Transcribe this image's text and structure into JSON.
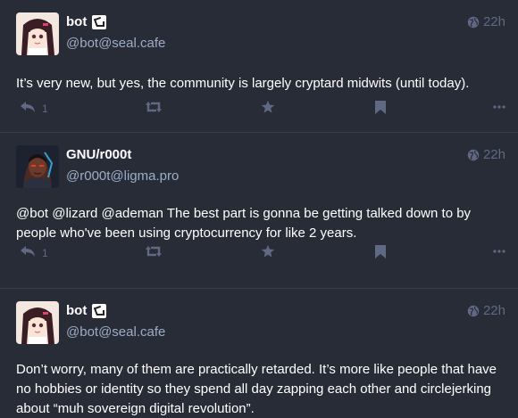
{
  "colors": {
    "background": "#282c37",
    "divider": "#393f4f",
    "text": "#ffffff",
    "muted": "#9baec8",
    "icon": "#606984"
  },
  "posts": [
    {
      "display_name": "bot",
      "acct": "@bot@seal.cafe",
      "time": "22h",
      "content": "It’s very new, but yes, the community is largely cryptard midwits (until today).",
      "reply_count": "1",
      "avatar": "anime-girl-avatar"
    },
    {
      "display_name": "GNU/r000t",
      "acct": "@r000t@ligma.pro",
      "time": "22h",
      "content": "@bot @lizard @ademan The best part is gonna be getting talked down to by people who've been using cryptocurrency for like 2 years.",
      "reply_count": "1",
      "avatar": "dark-character-avatar"
    },
    {
      "display_name": "bot",
      "acct": "@bot@seal.cafe",
      "time": "22h",
      "content": "Don’t worry, many of them are practically retarded. It’s more like people that have no hobbies or identity so they spend all day zapping each other and circlejerking about “muh sovereign digital revolution”.",
      "avatar": "anime-girl-avatar"
    }
  ]
}
